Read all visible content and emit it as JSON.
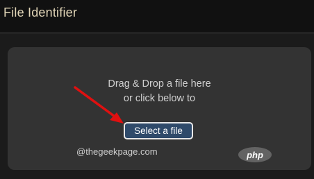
{
  "header": {
    "title": "File Identifier"
  },
  "drop_zone": {
    "line1": "Drag & Drop a file here",
    "line2": "or click below to",
    "select_button_label": "Select a file"
  },
  "watermark": {
    "text": "@thegeekpage.com"
  },
  "php_logo_text": "php",
  "colors": {
    "header_bg": "#111111",
    "title": "#e2d6b8",
    "panel_bg": "#333333",
    "button_bg": "#2f4a6a",
    "arrow": "#e01010"
  }
}
